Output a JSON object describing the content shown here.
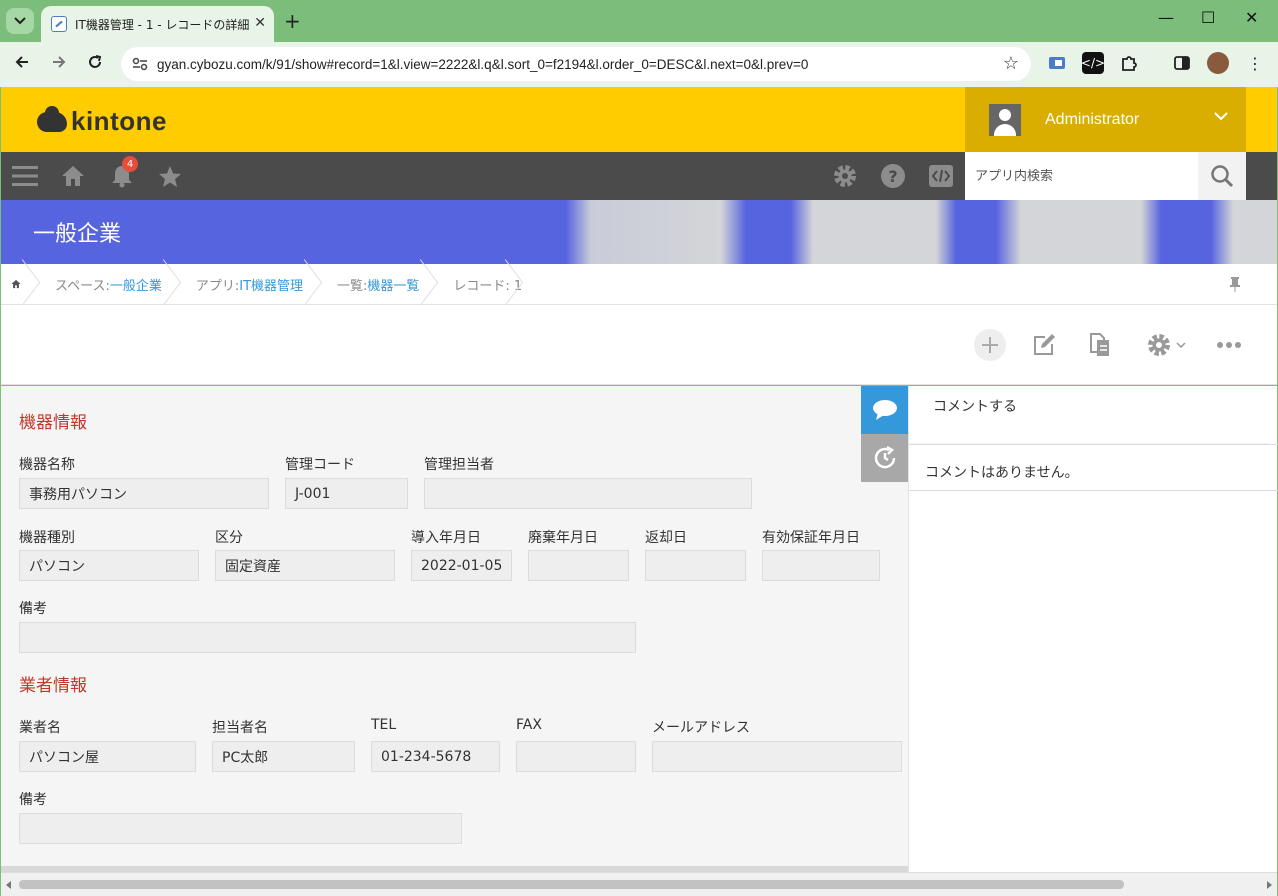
{
  "browser": {
    "tab_title": "IT機器管理 - 1 - レコードの詳細",
    "url": "gyan.cybozu.com/k/91/show#record=1&l.view=2222&l.q&l.sort_0=f2194&l.order_0=DESC&l.next=0&l.prev=0",
    "new_tab": "+",
    "close": "✕",
    "minimize": "—",
    "maximize": "☐"
  },
  "header": {
    "logo_text": "kintone",
    "user_name": "Administrator",
    "notification_count": "4",
    "search_placeholder": "アプリ内検索"
  },
  "space": {
    "title": "一般企業"
  },
  "breadcrumb": {
    "space_label": "スペース: ",
    "space_value": "一般企業",
    "app_label": "アプリ: ",
    "app_value": "IT機器管理",
    "view_label": "一覧: ",
    "view_value": "機器一覧",
    "record_label": "レコード: 1"
  },
  "form": {
    "section1": "機器情報",
    "fields1": {
      "device_name_label": "機器名称",
      "device_name": "事務用パソコン",
      "code_label": "管理コード",
      "code": "J-001",
      "manager_label": "管理担当者",
      "manager": "",
      "type_label": "機器種別",
      "type": "パソコン",
      "category_label": "区分",
      "category": "固定資産",
      "intro_date_label": "導入年月日",
      "intro_date": "2022-01-05",
      "disposal_date_label": "廃棄年月日",
      "disposal_date": "",
      "return_date_label": "返却日",
      "return_date": "",
      "warranty_label": "有効保証年月日",
      "warranty": "",
      "note_label": "備考",
      "note": ""
    },
    "section2": "業者情報",
    "fields2": {
      "vendor_label": "業者名",
      "vendor": "パソコン屋",
      "contact_label": "担当者名",
      "contact": "PC太郎",
      "tel_label": "TEL",
      "tel": "01-234-5678",
      "fax_label": "FAX",
      "fax": "",
      "email_label": "メールアドレス",
      "email": "",
      "note_label": "備考",
      "note": ""
    }
  },
  "comments": {
    "input_placeholder": "コメントする",
    "empty_text": "コメントはありません。"
  },
  "colors": {
    "header_yellow": "#ffcc00",
    "user_box": "#d9ae00",
    "nav_dark": "#4b4b4b",
    "section_red": "#c0392b",
    "link_blue": "#3498db",
    "comment_tab_blue": "#3498db"
  }
}
